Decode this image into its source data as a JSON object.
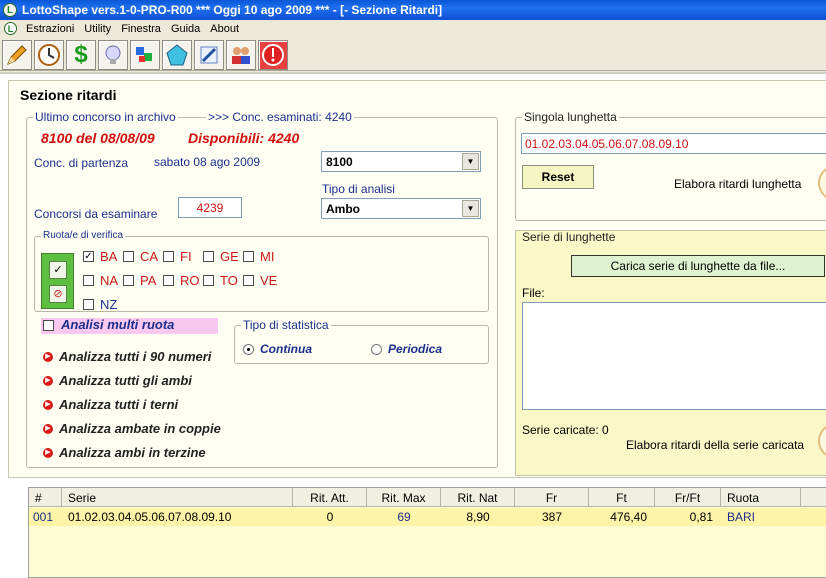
{
  "window": {
    "title": "LottoShape vers.1-0-PRO-R00  ***  Oggi 10 ago 2009  ***  - [- Sezione Ritardi]"
  },
  "menu": [
    "Estrazioni",
    "Utility",
    "Finestra",
    "Guida",
    "About"
  ],
  "toolbar": {
    "icons": [
      "pencil-icon",
      "clock-icon",
      "dollar-icon",
      "lightbulb-icon",
      "puzzle-icon",
      "shape-icon",
      "pen-edit-icon",
      "users-icon",
      "stop-icon"
    ]
  },
  "section": {
    "title": "Sezione ritardi"
  },
  "archive": {
    "legend": "Ultimo concorso in archivo",
    "examined": ">>> Conc. esaminati: 4240",
    "last_draw": "8100 del 08/08/09",
    "available": "Disponibili: 4240",
    "start_label": "Conc. di partenza",
    "start_date": "sabato 08 ago 2009",
    "start_combo": "8100",
    "analysis_label": "Tipo di analisi",
    "analysis_combo": "Ambo",
    "count_label": "Concorsi da esaminare",
    "count_value": "4239"
  },
  "wheels": {
    "legend": "Ruota/e di verifica",
    "items": [
      {
        "label": "BA",
        "checked": true
      },
      {
        "label": "CA",
        "checked": false
      },
      {
        "label": "FI",
        "checked": false
      },
      {
        "label": "GE",
        "checked": false
      },
      {
        "label": "MI",
        "checked": false
      },
      {
        "label": "NA",
        "checked": false
      },
      {
        "label": "PA",
        "checked": false
      },
      {
        "label": "RO",
        "checked": false
      },
      {
        "label": "TO",
        "checked": false
      },
      {
        "label": "VE",
        "checked": false
      },
      {
        "label": "NZ",
        "checked": false
      }
    ],
    "multi_label": "Analisi multi ruota"
  },
  "stats": {
    "legend": "Tipo di statistica",
    "continua": "Continua",
    "periodica": "Periodica",
    "selected": "continua"
  },
  "actions": [
    "Analizza tutti i 90 numeri",
    "Analizza tutti gli ambi",
    "Analizza tutti i terni",
    "Analizza ambate in coppie",
    "Analizza ambi in terzine"
  ],
  "single": {
    "legend": "Singola lunghetta",
    "value": "01.02.03.04.05.06.07.08.09.10",
    "reset": "Reset",
    "process": "Elabora ritardi lunghetta"
  },
  "series": {
    "legend": "Serie di lunghette",
    "load_button": "Carica serie di lunghette da file...",
    "file_label": "File:",
    "loaded": "Serie caricate: 0",
    "process": "Elabora ritardi della serie caricata"
  },
  "table": {
    "headers": [
      "#",
      "Serie",
      "Rit. Att.",
      "Rit. Max",
      "Rit. Nat",
      "Fr",
      "Ft",
      "Fr/Ft",
      "Ruota"
    ],
    "rows": [
      [
        "001",
        "01.02.03.04.05.06.07.08.09.10",
        "0",
        "69",
        "8,90",
        "387",
        "476,40",
        "0,81",
        "BARI"
      ]
    ]
  },
  "colors": {
    "accent_red": "#d21010",
    "label_blue": "#1c2f8c",
    "panel_yellow": "#fbf8c8"
  }
}
